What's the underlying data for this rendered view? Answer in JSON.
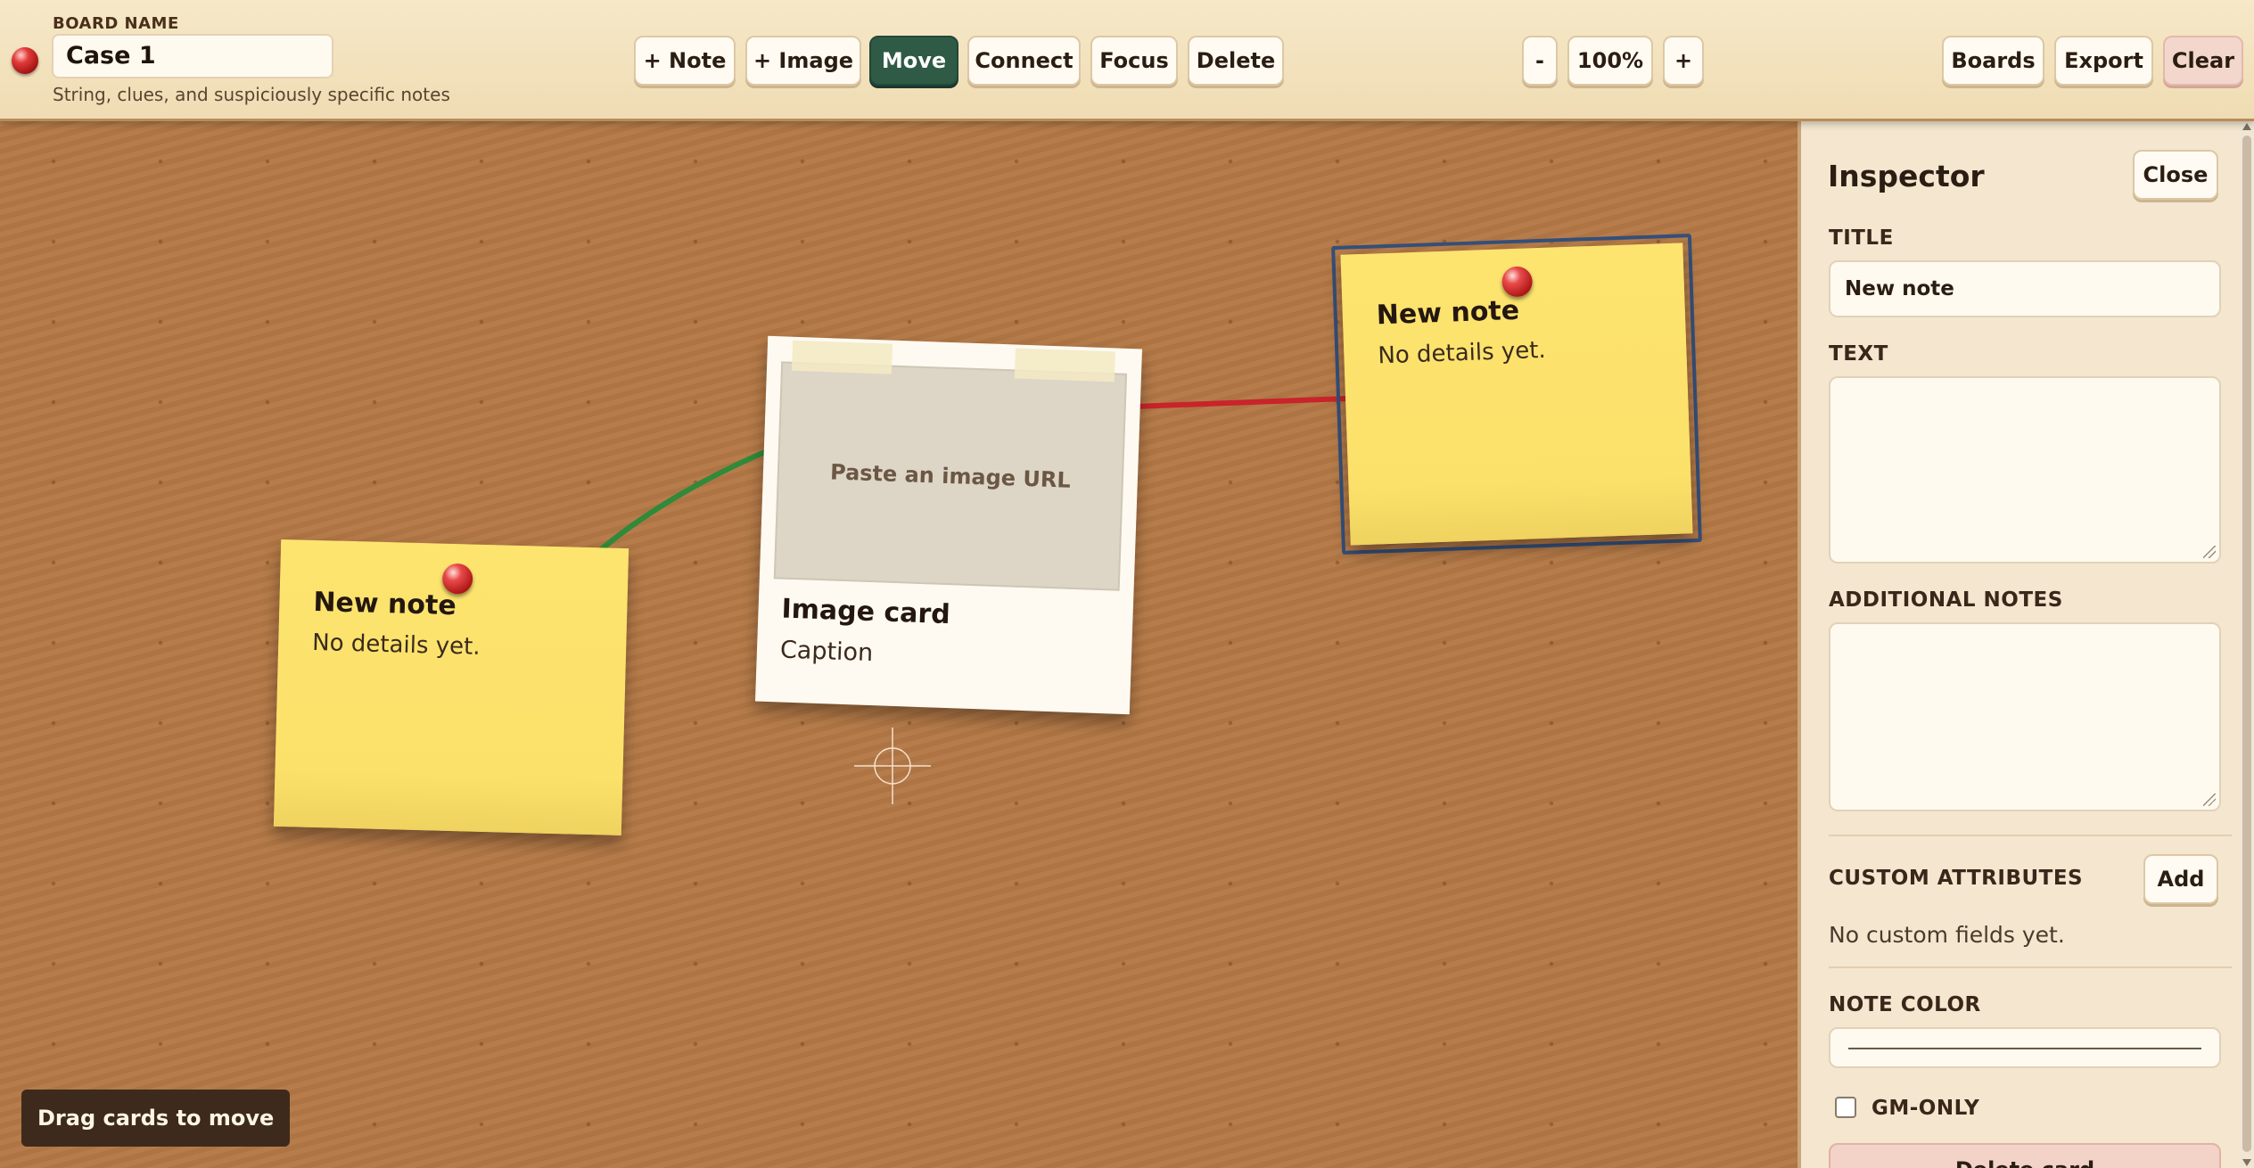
{
  "header": {
    "board_label": "BOARD NAME",
    "board_name": "Case 1",
    "subtitle": "String, clues, and suspiciously specific notes"
  },
  "toolbar": {
    "add_note": "+ Note",
    "add_image": "+ Image",
    "move": "Move",
    "connect": "Connect",
    "focus": "Focus",
    "delete": "Delete",
    "active_mode": "Move"
  },
  "zoom": {
    "out": "-",
    "level": "100%",
    "in": "+"
  },
  "actions": {
    "boards": "Boards",
    "export": "Export",
    "clear": "Clear"
  },
  "board": {
    "notes": [
      {
        "title": "New note",
        "text": "No details yet.",
        "selected": false
      },
      {
        "title": "New note",
        "text": "No details yet.",
        "selected": true
      }
    ],
    "image_card": {
      "placeholder": "Paste an image URL",
      "title": "Image card",
      "caption": "Caption"
    },
    "strings": [
      {
        "from": "note-1",
        "to": "image-card",
        "color": "#2f8a3a"
      },
      {
        "from": "image-card",
        "to": "note-2",
        "color": "#c8242a"
      }
    ],
    "hint": "Drag cards to move"
  },
  "inspector": {
    "title": "Inspector",
    "close": "Close",
    "title_label": "TITLE",
    "title_value": "New note",
    "text_label": "TEXT",
    "text_value": "",
    "notes_label": "ADDITIONAL NOTES",
    "notes_value": "",
    "custom_label": "CUSTOM ATTRIBUTES",
    "add": "Add",
    "custom_empty": "No custom fields yet.",
    "color_label": "NOTE COLOR",
    "gm_only_label": "GM-ONLY",
    "gm_only_checked": false,
    "delete_card": "Delete card"
  },
  "colors": {
    "note_yellow": "#fbe16a",
    "active_button": "#2f5a45",
    "selection_outline": "#35507a",
    "cork": "#b47845"
  }
}
